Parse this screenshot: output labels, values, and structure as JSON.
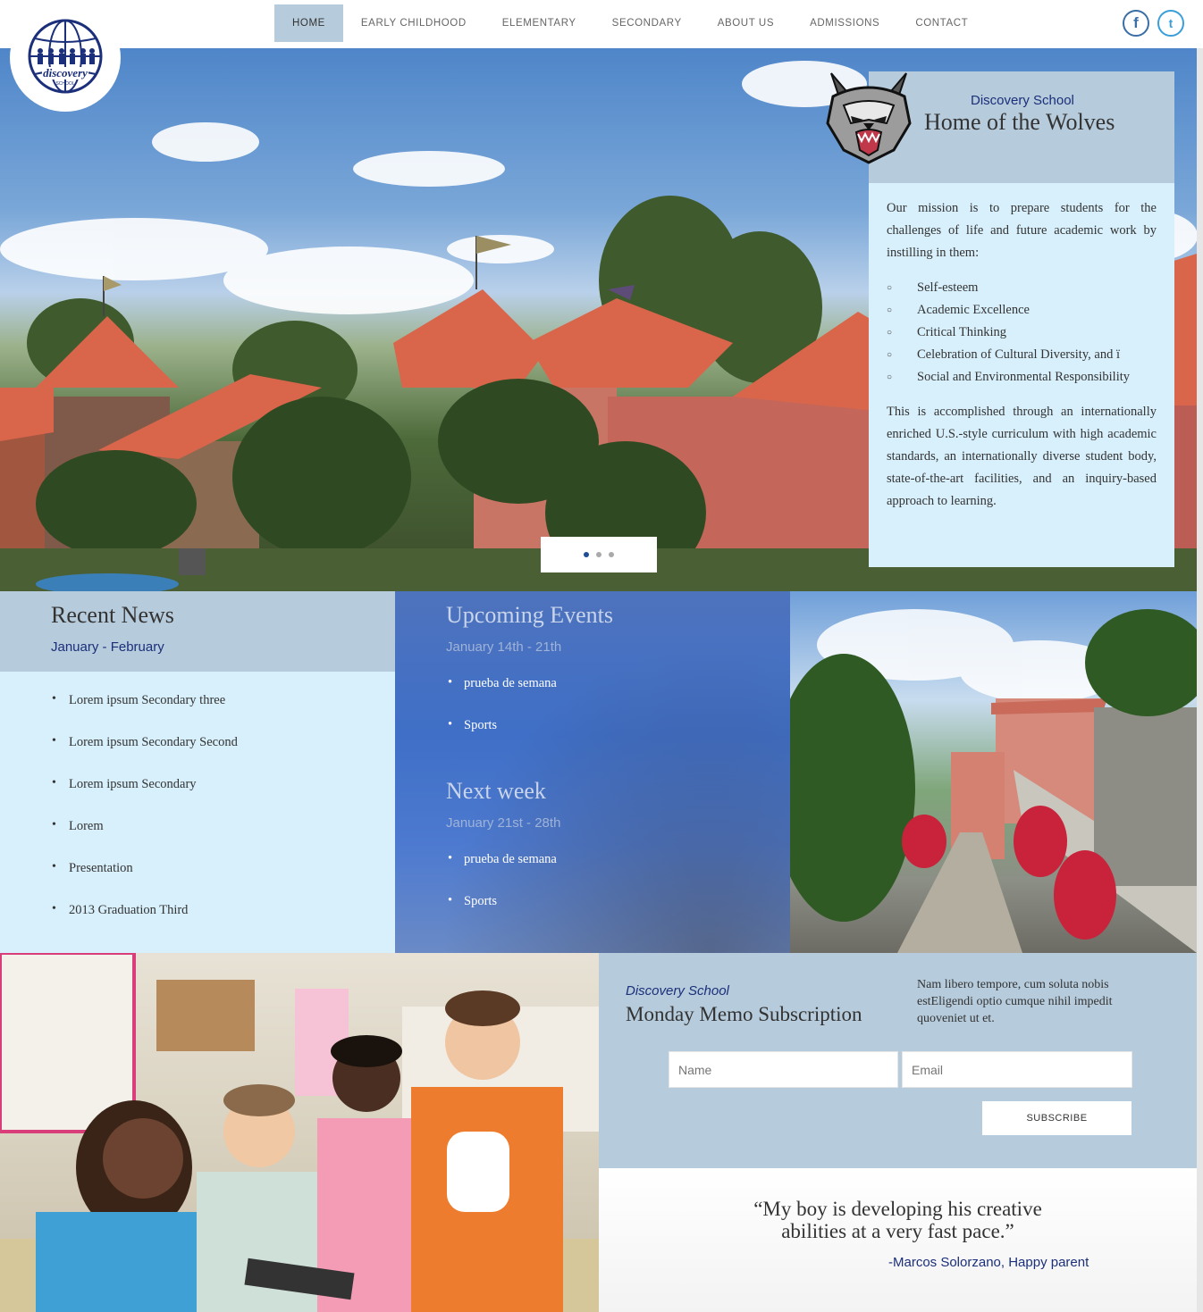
{
  "nav": {
    "items": [
      {
        "label": "HOME",
        "active": true
      },
      {
        "label": "EARLY CHILDHOOD",
        "active": false
      },
      {
        "label": "ELEMENTARY",
        "active": false
      },
      {
        "label": "SECONDARY",
        "active": false
      },
      {
        "label": "ABOUT US",
        "active": false
      },
      {
        "label": "ADMISSIONS",
        "active": false
      },
      {
        "label": "CONTACT",
        "active": false
      }
    ],
    "social": {
      "facebook": "f",
      "twitter": "t"
    }
  },
  "logo": {
    "text": "discovery",
    "subtext": "SCHOOL"
  },
  "hero": {
    "dots": 3,
    "active_dot": 1
  },
  "mission": {
    "brand": "Discovery School",
    "title": "Home of the Wolves",
    "intro": "Our mission is to prepare students for the challenges of life and future academic work by instilling in them:",
    "values": [
      "Self-esteem",
      "Academic Excellence",
      "Critical Thinking",
      "Celebration of Cultural Diversity, and ï",
      "Social and Environmental Responsibility"
    ],
    "closing": "This is accomplished through an internationally enriched U.S.-style curriculum with high academic standards, an internationally diverse student body, state-of-the-art facilities, and an inquiry-based approach to learning."
  },
  "news": {
    "title": "Recent News",
    "period": "January - February",
    "items": [
      "Lorem ipsum Secondary three",
      "Lorem ipsum Secondary Second",
      "Lorem ipsum Secondary",
      "Lorem",
      "Presentation",
      "2013 Graduation Third"
    ]
  },
  "events": {
    "title": "Upcoming Events",
    "period": "January 14th - 21th",
    "items": [
      "prueba de semana",
      "Sports"
    ],
    "next_title": "Next week",
    "next_period": "January 21st - 28th",
    "next_items": [
      "prueba de semana",
      "Sports"
    ]
  },
  "subscription": {
    "brand": "Discovery School",
    "title": "Monday Memo Subscription",
    "text": "Nam libero tempore, cum soluta nobis estEligendi optio cumque nihil impedit quoveniet ut et.",
    "name_placeholder": "Name",
    "email_placeholder": "Email",
    "button": "SUBSCRIBE"
  },
  "testimonial": {
    "line1": "“My boy is developing his creative",
    "line2": "abilities at a very fast pace.”",
    "author": "-Marcos Solorzano, Happy parent"
  },
  "colors": {
    "accent": "#b6cbdb",
    "panel": "#d8f0fc",
    "brand_text": "#1b2f7a",
    "events_bg": "#4572c4"
  }
}
